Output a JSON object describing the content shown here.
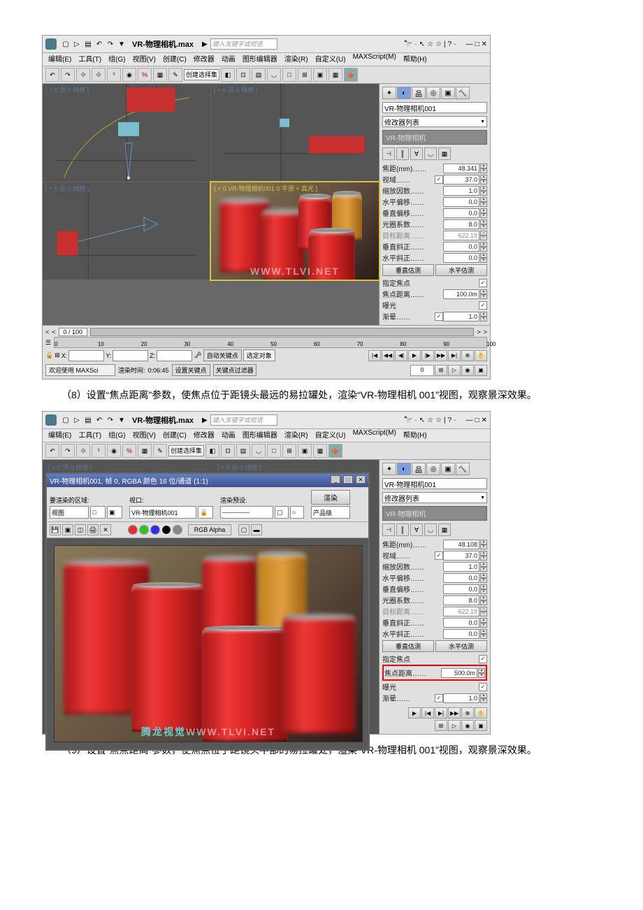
{
  "doc": {
    "para8": "（8）设置“焦点距离”参数，使焦点位于距镜头最远的易拉罐处，渲染“VR-物理相机 001”视图，观察景深效果。",
    "para9": "（9）设置“焦点距离”参数，使焦点位于距镜头中部的易拉罐处，渲染“VR-物理相机 001”视图，观察景深效果。"
  },
  "app": {
    "title": "VR-物理相机.max",
    "search_placeholder": "键入关键字或短语",
    "menus": [
      "编辑(E)",
      "工具(T)",
      "组(G)",
      "视图(V)",
      "创建(C)",
      "修改器",
      "动画",
      "图形编辑器",
      "渲染(R)",
      "自定义(U)",
      "MAXScript(M)",
      "帮助(H)"
    ],
    "quickset": "创建选择集"
  },
  "viewports": {
    "top": "[ + 0 顶 0 线框 ]",
    "front": "[ + 0 前 0 线框 ]",
    "left": "[ + 0 左 0 线框 ]",
    "persp": "[ + 0 VR-物理相机001 0 平滑 + 高光 ]"
  },
  "panel": {
    "object_name": "VR-物理相机001",
    "modifier_list": "修改器列表",
    "modifier_item": "VR-物理相机",
    "params1": [
      {
        "label": "焦距(mm)",
        "val": "48.341",
        "chk": null
      },
      {
        "label": "视域",
        "val": "37.0",
        "chk": "✓"
      },
      {
        "label": "缩放因数",
        "val": "1.0",
        "chk": null
      },
      {
        "label": "水平偏移",
        "val": "0.0",
        "chk": null
      },
      {
        "label": "垂直偏移",
        "val": "0.0",
        "chk": null
      },
      {
        "label": "光圈系数",
        "val": "8.0",
        "chk": null
      },
      {
        "label": "目标距离",
        "val": "622.19",
        "chk": null,
        "disabled": true
      },
      {
        "label": "垂直斜正",
        "val": "0.0",
        "chk": null
      },
      {
        "label": "水平斜正",
        "val": "0.0",
        "chk": null
      }
    ],
    "btn_v": "垂直估测",
    "btn_h": "水平估测",
    "focus_params1": [
      {
        "label": "指定焦点",
        "chk": "✓"
      },
      {
        "label": "焦点距离",
        "val": "100.0m"
      },
      {
        "label": "曝光",
        "chk": "✓"
      },
      {
        "label": "渐晕",
        "val": "1.0",
        "chk": "✓"
      }
    ],
    "params2": [
      {
        "label": "焦距(mm)",
        "val": "48.108",
        "chk": null
      },
      {
        "label": "视域",
        "val": "37.0",
        "chk": "✓"
      },
      {
        "label": "缩放因数",
        "val": "1.0",
        "chk": null
      },
      {
        "label": "水平偏移",
        "val": "0.0",
        "chk": null
      },
      {
        "label": "垂直偏移",
        "val": "0.0",
        "chk": null
      },
      {
        "label": "光圈系数",
        "val": "8.0",
        "chk": null
      },
      {
        "label": "目标距离",
        "val": "622.19",
        "chk": null,
        "disabled": true
      },
      {
        "label": "垂直斜正",
        "val": "0.0",
        "chk": null
      },
      {
        "label": "水平斜正",
        "val": "0.0",
        "chk": null
      }
    ],
    "focus_params2": [
      {
        "label": "指定焦点",
        "chk": "✓"
      },
      {
        "label": "焦点距离",
        "val": "500.0m",
        "highlight": true
      },
      {
        "label": "曝光",
        "chk": "✓"
      },
      {
        "label": "渐晕",
        "val": "1.0",
        "chk": "✓"
      }
    ]
  },
  "footer": {
    "slider_pos": "0 / 100",
    "ruler_ticks": [
      "0",
      "10",
      "20",
      "30",
      "40",
      "50",
      "60",
      "70",
      "80",
      "90",
      "100"
    ],
    "autokey": "自动关键点",
    "keysel": "选定对象",
    "setkey": "设置关键点",
    "keyfilter": "关键点过滤器",
    "welcome": "欢迎使用 MAXSci",
    "render_time_label": "渲染时间:",
    "render_time": "0:06:45",
    "frame": "0"
  },
  "render": {
    "title": "VR-物理相机001, 帧 0, RGBA 颜色 16 位/通道 (1:1)",
    "area_label": "要渲染的区域:",
    "area_val": "视图",
    "viewport_label": "视口:",
    "viewport_val": "VR-物理相机001",
    "preset_label": "渲染预设:",
    "preset_val": "-------------",
    "prod_label": "产品级",
    "render_btn": "渲染",
    "channel": "RGB Alpha"
  },
  "watermark": "WWW.TLVI.NET",
  "watermark2_prefix": "腾龙视觉"
}
